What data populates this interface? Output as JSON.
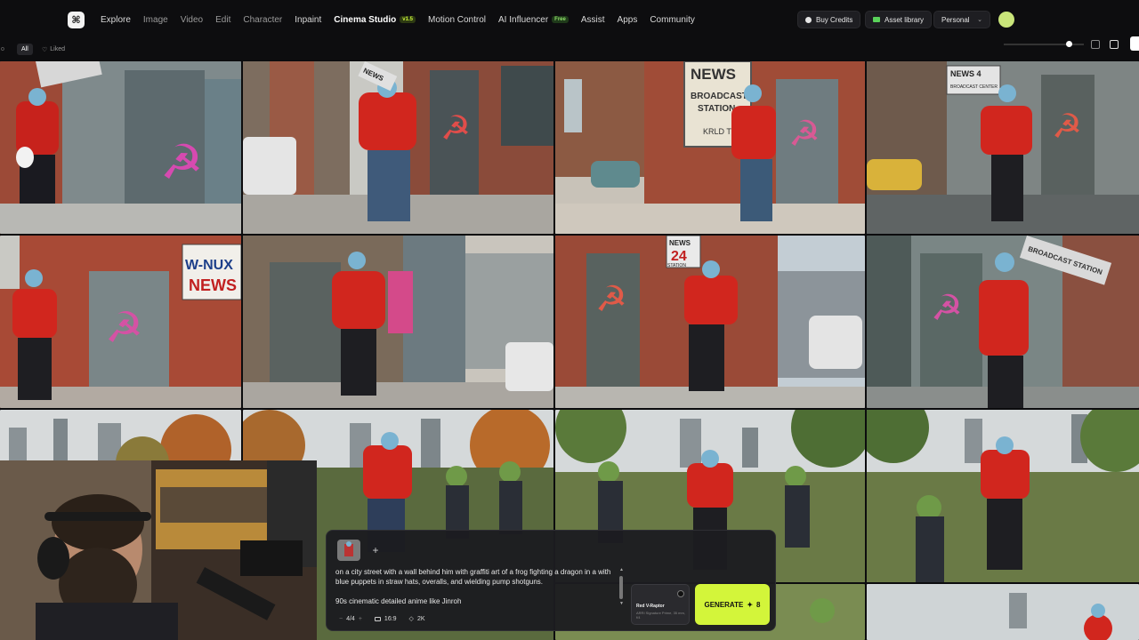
{
  "nav": {
    "items": [
      {
        "label": "Explore"
      },
      {
        "label": "Image"
      },
      {
        "label": "Video"
      },
      {
        "label": "Edit"
      },
      {
        "label": "Character"
      },
      {
        "label": "Inpaint"
      },
      {
        "label": "Cinema Studio",
        "badge": "v1.5"
      },
      {
        "label": "Motion Control"
      },
      {
        "label": "AI Influencer",
        "badge": "Free"
      },
      {
        "label": "Assist"
      },
      {
        "label": "Apps"
      },
      {
        "label": "Community"
      }
    ],
    "buy_credits": "Buy Credits",
    "asset_library": "Asset library",
    "workspace": "Personal"
  },
  "subbar": {
    "all": "All",
    "liked": "Liked"
  },
  "prompt": {
    "text": "on a city street with a wall behind him with graffiti art of a frog fighting a dragon in a with blue puppets in straw hats, overalls, and wielding pump shotguns.",
    "extra": "90s cinematic detailed anime like Jinroh",
    "count": "4/4",
    "aspect": "16:9",
    "resolution": "2K",
    "model_name": "Red V-Raptor",
    "model_sub": "ARRI Signature Prime, 35 mm, f/4",
    "generate_label": "GENERATE",
    "credits": "8"
  },
  "tiles": {
    "r1c2": "NEWS",
    "r1c3a": "NEWS",
    "r1c3b": "BROADCAST",
    "r1c3c": "STATION",
    "r1c3d": "KRLD TV",
    "r1c4a": "NEWS 4",
    "r1c4b": "BROADCAST CENTER",
    "r2c1a": "W-NUX",
    "r2c1b": "NEWS",
    "r2c3a": "NEWS",
    "r2c3b": "24",
    "r2c3c": "STATION",
    "r2c4": "BROADCAST STATION"
  },
  "colors": {
    "accent": "#d3f53a",
    "background": "#0c0c0e"
  }
}
